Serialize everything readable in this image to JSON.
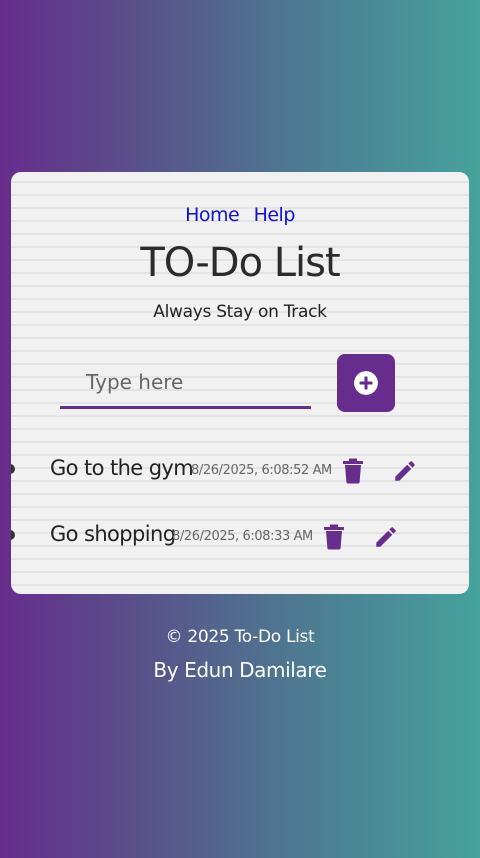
{
  "nav": {
    "links": [
      {
        "label": "Home"
      },
      {
        "label": "Help"
      }
    ]
  },
  "header": {
    "title": "TO-Do List",
    "subtitle": "Always Stay on Track"
  },
  "new_task": {
    "placeholder": "Type here",
    "value": "",
    "add_icon": "plus-circle-icon"
  },
  "tasks": [
    {
      "text": "Go to the gym",
      "timestamp": "8/26/2025, 6:08:52 AM",
      "delete_icon": "trash-icon",
      "edit_icon": "pencil-icon"
    },
    {
      "text": "Go shopping",
      "timestamp": "8/26/2025, 6:08:33 AM",
      "delete_icon": "trash-icon",
      "edit_icon": "pencil-icon"
    }
  ],
  "footer": {
    "copyright": "© 2025 To-Do List",
    "author": "By Edun Damilare"
  },
  "colors": {
    "accent": "#662d8c",
    "link": "#1010d8",
    "gradient_start": "#662d8c",
    "gradient_end": "#46a29c"
  }
}
